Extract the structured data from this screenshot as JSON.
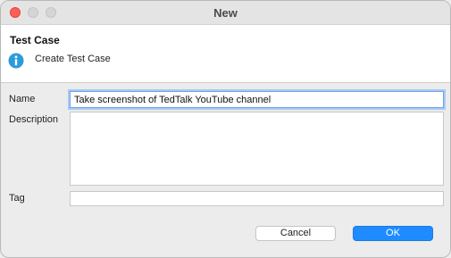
{
  "window": {
    "title": "New"
  },
  "header": {
    "title": "Test Case",
    "subtitle": "Create Test Case",
    "icon": "info-icon"
  },
  "form": {
    "name_label": "Name",
    "name_value": "Take screenshot of TedTalk YouTube channel",
    "description_label": "Description",
    "description_value": "",
    "tag_label": "Tag",
    "tag_value": ""
  },
  "buttons": {
    "cancel_label": "Cancel",
    "ok_label": "OK"
  },
  "colors": {
    "ok_button": "#1e8cff",
    "close_traffic_light": "#fe5f57",
    "info_icon": "#2b9bdc"
  }
}
